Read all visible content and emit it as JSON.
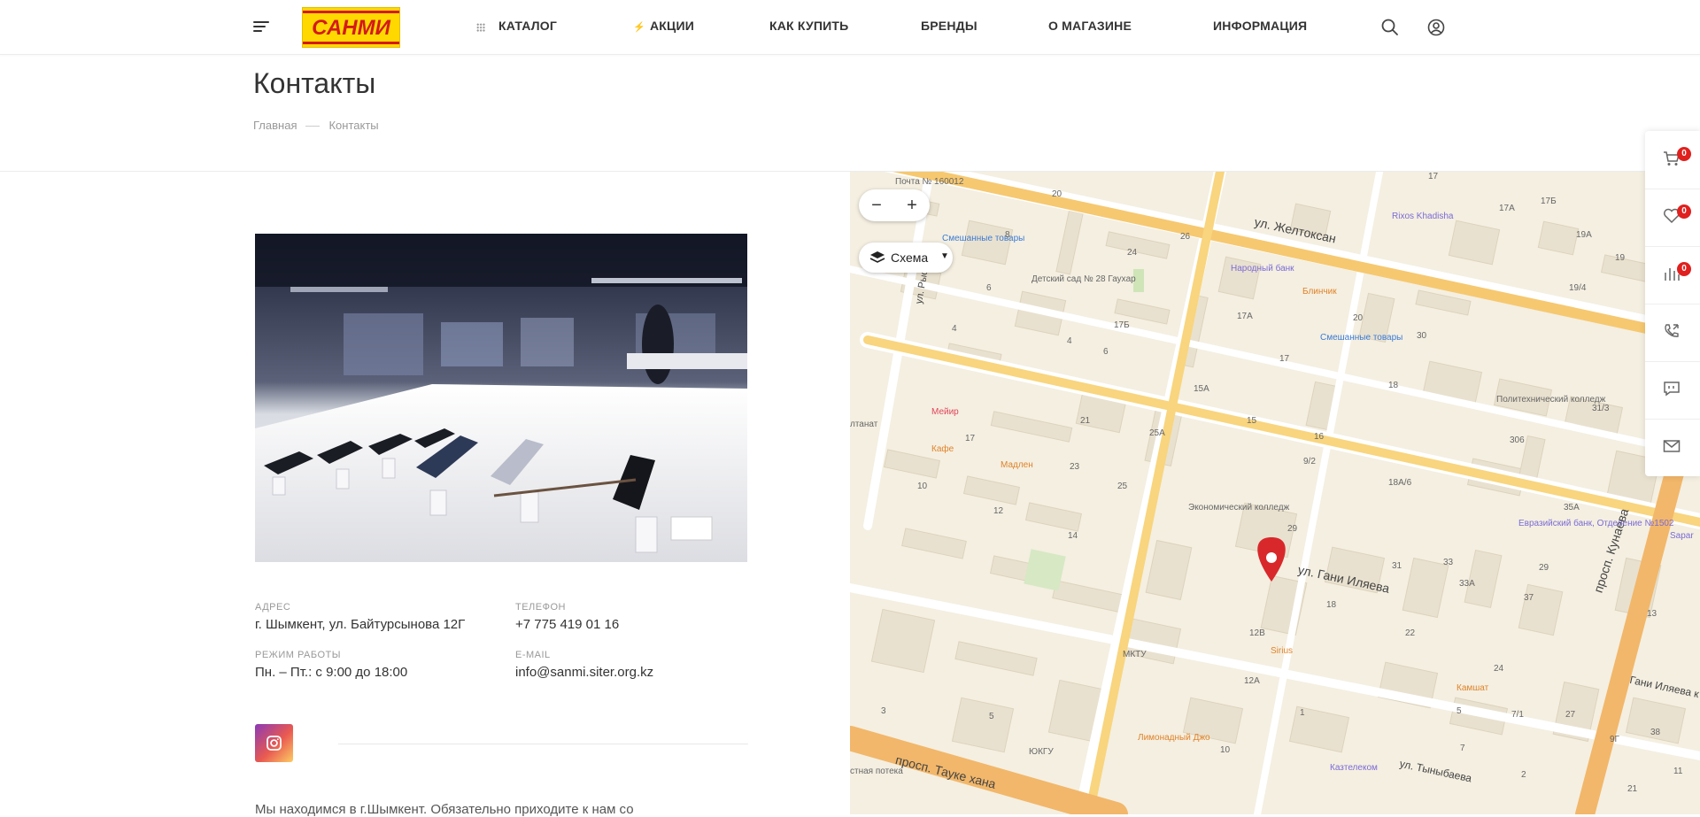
{
  "header": {
    "logo_text": "САНМИ",
    "nav": [
      "КАТАЛОГ",
      "АКЦИИ",
      "КАК КУПИТЬ",
      "БРЕНДЫ",
      "О МАГАЗИНЕ",
      "ИНФОРМАЦИЯ"
    ],
    "icons": [
      "menu-icon",
      "grid-icon",
      "lightning-icon",
      "search-icon",
      "user-icon"
    ]
  },
  "page": {
    "title": "Контакты",
    "breadcrumb": [
      "Главная",
      "Контакты"
    ]
  },
  "contacts": {
    "address_label": "АДРЕС",
    "address": "г. Шымкент, ул. Байтурсынова 12Г",
    "phone_label": "ТЕЛЕФОН",
    "phone": "+7 775 419 01 16",
    "hours_label": "РЕЖИМ РАБОТЫ",
    "hours": "Пн. – Пт.: с 9:00 до 18:00",
    "email_label": "E-MAIL",
    "email": "info@sanmi.siter.org.kz",
    "bottom_text": "Мы находимся в г.Шымкент. Обязательно приходите к нам со"
  },
  "map": {
    "zoom_out": "−",
    "zoom_in": "+",
    "layer_label": "Схема",
    "streets": [
      "ул. Желтоксан",
      "ул. Гани Иляева",
      "просп. Кунаева",
      "просп. Тауке хана",
      "ул. Тыныбаева",
      "ул. Рыскулбе",
      "Гани Иляева к"
    ],
    "pois": [
      "Почта № 160012",
      "Смешанные товары",
      "Детский сад № 28 Гаухар",
      "Народный банк",
      "Блинчик",
      "Rixos Khadisha",
      "Смешанные товары",
      "Мейир",
      "Кафе",
      "Мадлен",
      "Политехнический колледж",
      "Экономический колледж",
      "Евразийский банк, Отделение №1502",
      "Sirius",
      "МКТУ",
      "Камшат",
      "Лимонадный Джо",
      "ЮКГУ",
      "Казтелеком",
      "Sapar",
      "лтанат",
      "стная потека"
    ],
    "numbers": [
      "20",
      "17",
      "17А",
      "17Б",
      "19А",
      "19",
      "8",
      "26",
      "24",
      "6",
      "17Б",
      "19/4",
      "4",
      "17А",
      "20",
      "30",
      "4",
      "6",
      "17",
      "18",
      "15А",
      "21",
      "15",
      "25А",
      "17",
      "23",
      "16",
      "9/2",
      "306",
      "31/3",
      "10",
      "25",
      "12",
      "18А/6",
      "35А",
      "14",
      "29",
      "33",
      "31",
      "33А",
      "37",
      "29",
      "13",
      "18",
      "22",
      "12В",
      "24",
      "12А",
      "5",
      "7/1",
      "27",
      "9Г",
      "38",
      "3",
      "5",
      "1",
      "7",
      "2",
      "21",
      "10",
      "11"
    ]
  },
  "float_panel": {
    "cart_count": "0",
    "favorites_count": "0",
    "compare_count": "0"
  }
}
